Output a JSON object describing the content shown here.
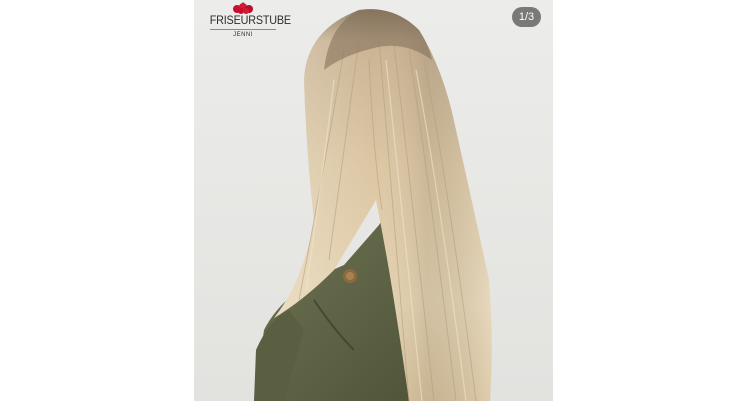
{
  "gallery": {
    "counter": "1/3",
    "photo_subject": "long straight blonde balayage hair, back view, olive jacket",
    "background_color": "#ffffff"
  },
  "logo": {
    "name": "FRISEURSTUBE",
    "subtitle": "JENNI",
    "icon": "cherries-icon",
    "accent_color": "#c8102e"
  }
}
